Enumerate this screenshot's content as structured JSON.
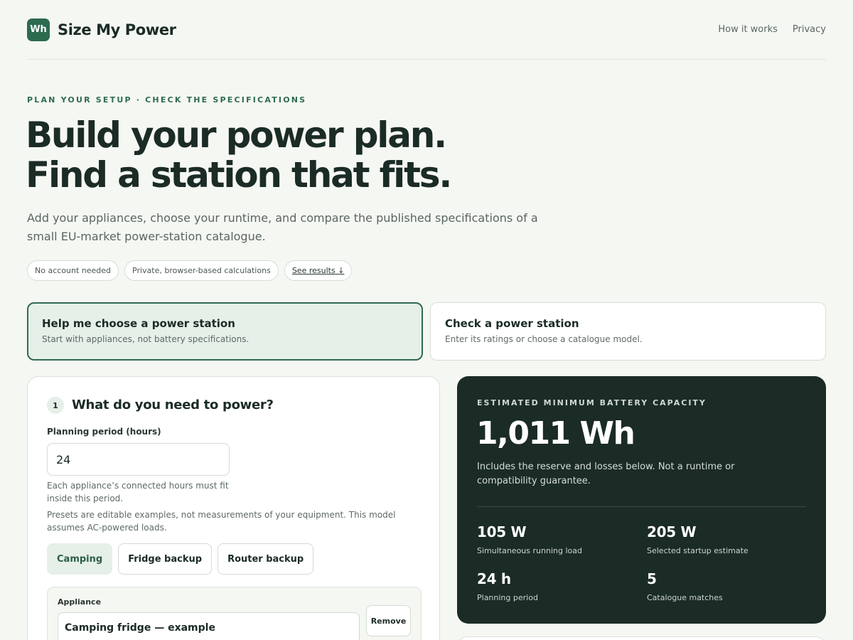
{
  "header": {
    "logo_text": "Wh",
    "brand": "Size My Power",
    "nav": [
      "How it works",
      "Privacy"
    ]
  },
  "hero": {
    "eyebrow": "PLAN YOUR SETUP · CHECK THE SPECIFICATIONS",
    "title_line1": "Build your power plan.",
    "title_line2": "Find a station that fits.",
    "subtitle": "Add your appliances, choose your runtime, and compare the published specifications of a small EU-market power-station catalogue.",
    "pills": [
      "No account needed",
      "Private, browser-based calculations"
    ],
    "see_results": "See results",
    "see_results_icon": "↓"
  },
  "modes": {
    "choose": {
      "title": "Help me choose a power station",
      "subtitle": "Start with appliances, not battery specifications."
    },
    "check": {
      "title": "Check a power station",
      "subtitle": "Enter its ratings or choose a catalogue model."
    }
  },
  "planner": {
    "step": "1",
    "title": "What do you need to power?",
    "period_label": "Planning period (hours)",
    "period_value": "24",
    "help1": "Each appliance’s connected hours must fit inside this period.",
    "help2": "Presets are editable examples, not measurements of your equipment. This model assumes AC-powered loads.",
    "presets": [
      "Camping",
      "Fridge backup",
      "Router backup"
    ],
    "active_preset": "Camping",
    "appliance_label": "Appliance",
    "appliance_value": "Camping fridge — example",
    "remove_label": "Remove"
  },
  "result": {
    "eyebrow": "ESTIMATED MINIMUM BATTERY CAPACITY",
    "value": "1,011 Wh",
    "note": "Includes the reserve and losses below. Not a runtime or compatibility guarantee.",
    "stats": [
      {
        "value": "105 W",
        "label": "Simultaneous running load"
      },
      {
        "value": "205 W",
        "label": "Selected startup estimate"
      },
      {
        "value": "24 h",
        "label": "Planning period"
      },
      {
        "value": "5",
        "label": "Catalogue matches"
      }
    ]
  },
  "colors": {
    "accent": "#2f6b52",
    "dark_panel": "#1b2b26",
    "background": "#f5f7f2",
    "active_tint": "#e6efe8"
  }
}
